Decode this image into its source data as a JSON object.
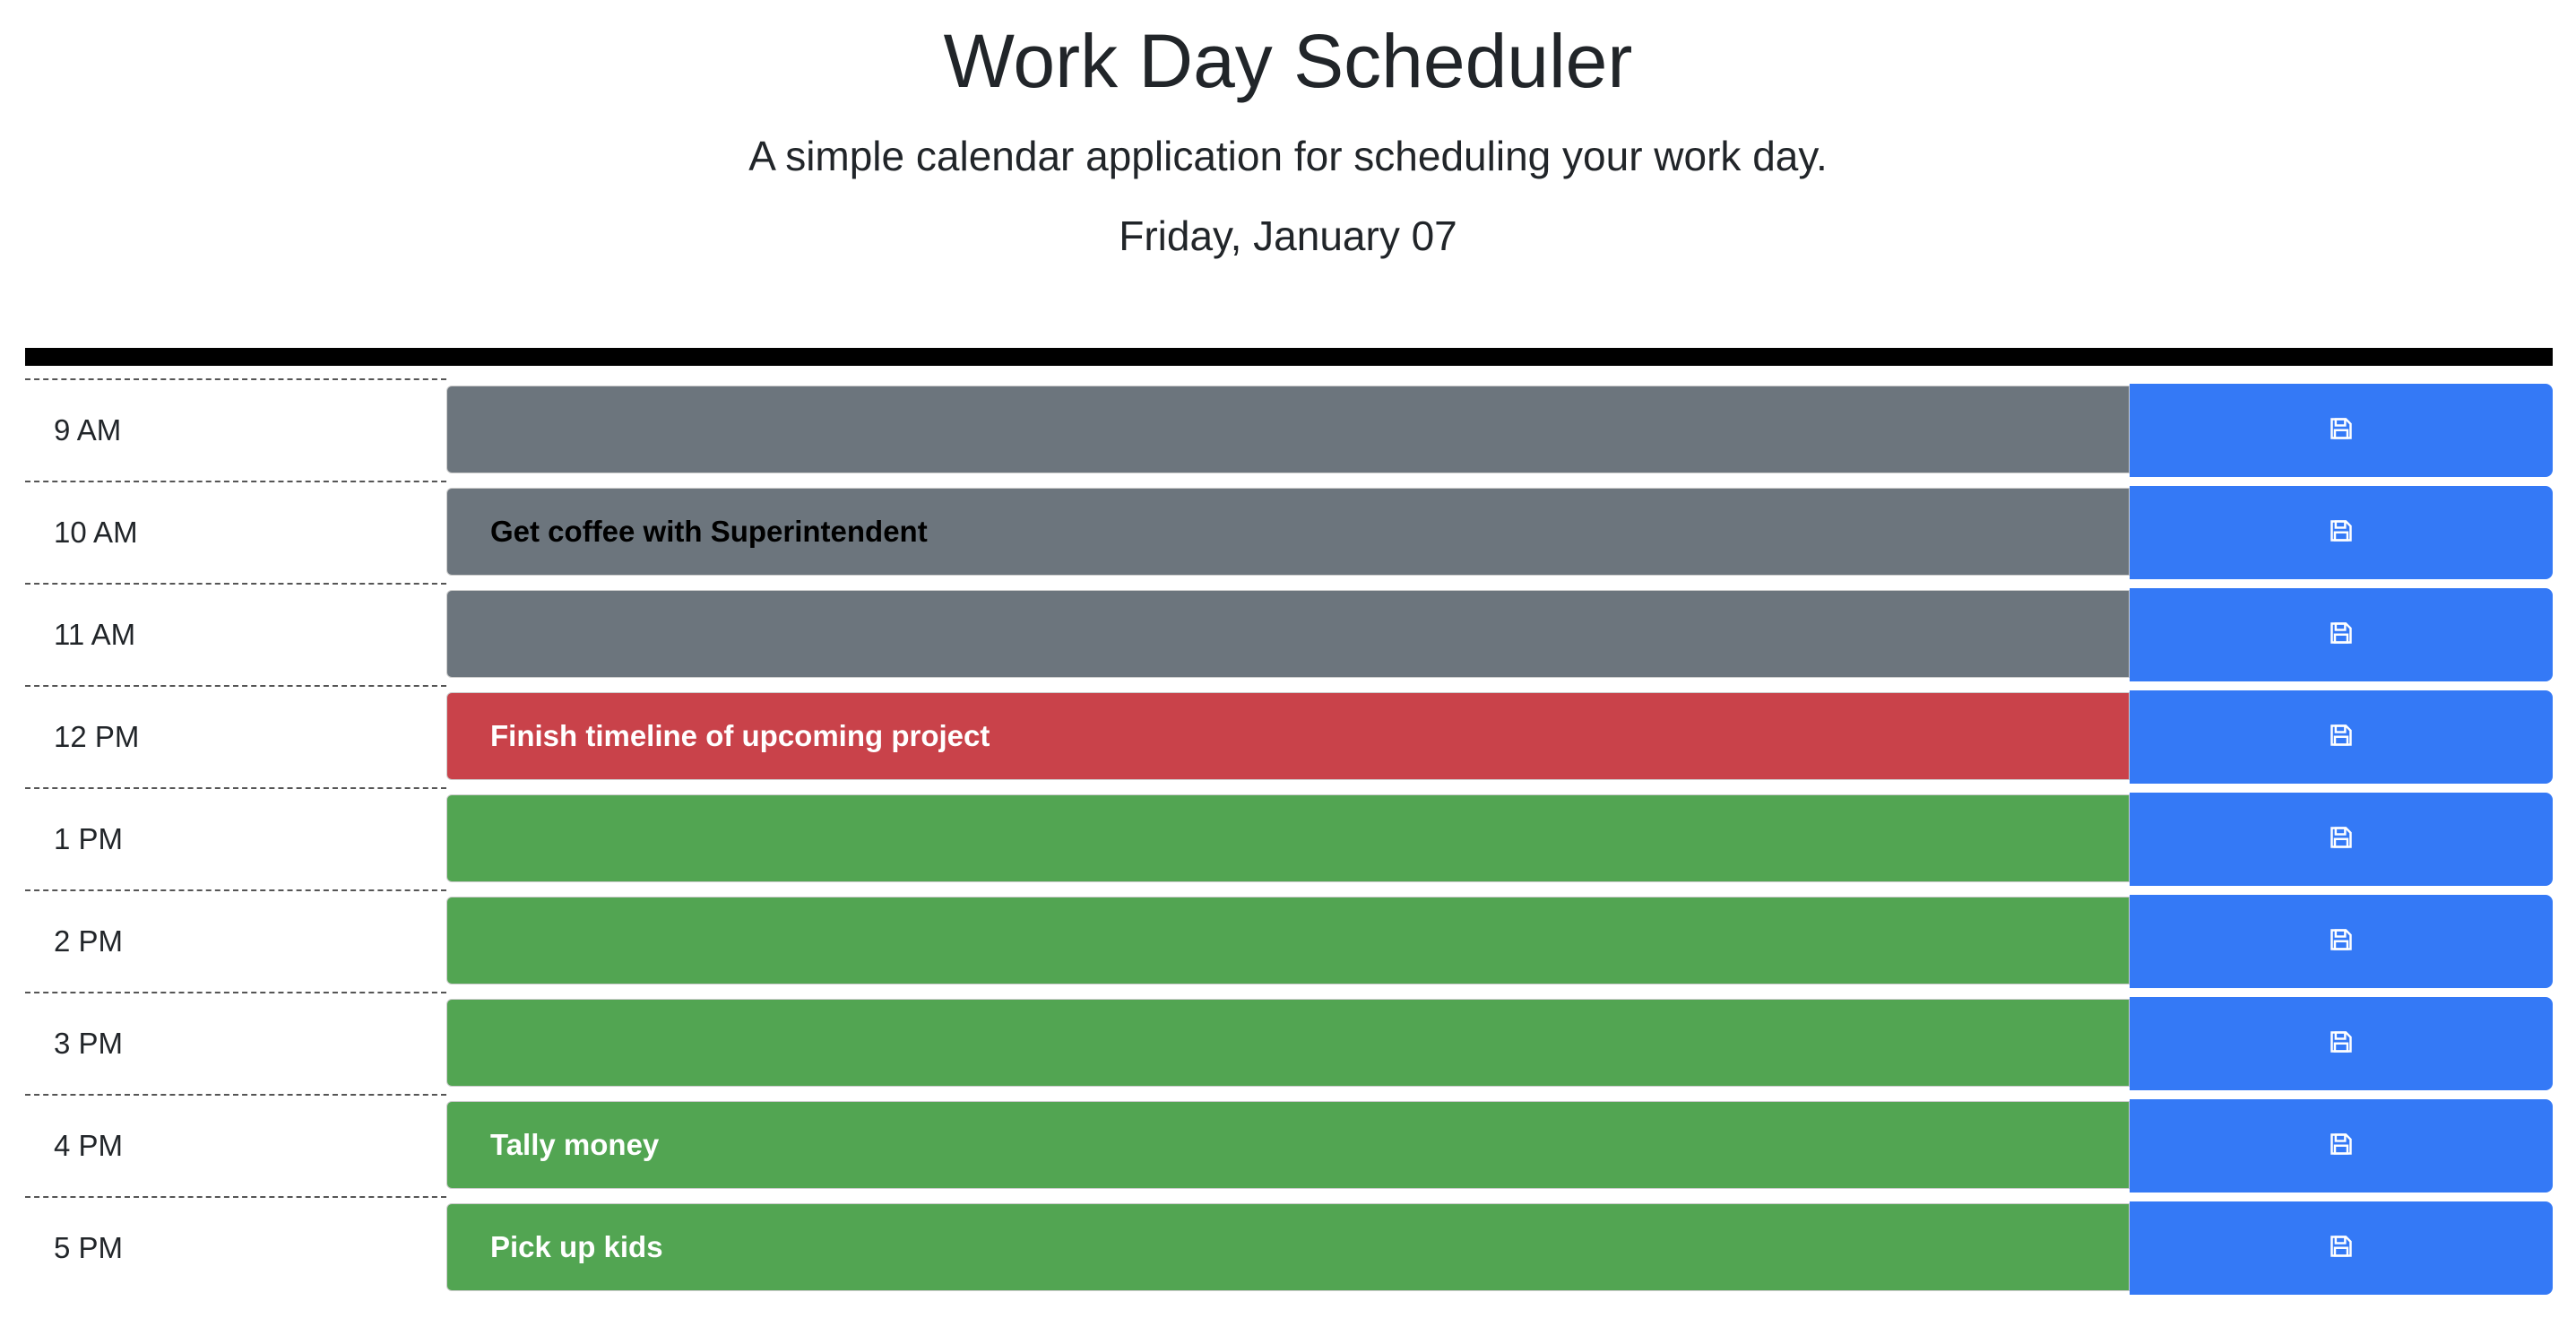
{
  "header": {
    "title": "Work Day Scheduler",
    "lead": "A simple calendar application for scheduling your work day.",
    "date": "Friday, January 07"
  },
  "colors": {
    "past": "#6c757d",
    "present": "#c9424a",
    "future": "#52a552",
    "save": "#3479f6"
  },
  "rows": [
    {
      "hour": "9 AM",
      "text": "",
      "state": "past",
      "save_icon": "floppy-disk-icon"
    },
    {
      "hour": "10 AM",
      "text": "Get coffee with Superintendent",
      "state": "past",
      "save_icon": "floppy-disk-icon"
    },
    {
      "hour": "11 AM",
      "text": "",
      "state": "past",
      "save_icon": "floppy-disk-icon"
    },
    {
      "hour": "12 PM",
      "text": "Finish timeline of upcoming project",
      "state": "present",
      "save_icon": "floppy-disk-icon"
    },
    {
      "hour": "1 PM",
      "text": "",
      "state": "future",
      "save_icon": "floppy-disk-icon"
    },
    {
      "hour": "2 PM",
      "text": "",
      "state": "future",
      "save_icon": "floppy-disk-icon"
    },
    {
      "hour": "3 PM",
      "text": "",
      "state": "future",
      "save_icon": "floppy-disk-icon"
    },
    {
      "hour": "4 PM",
      "text": "Tally money",
      "state": "future",
      "save_icon": "floppy-disk-icon"
    },
    {
      "hour": "5 PM",
      "text": "Pick up kids",
      "state": "future",
      "save_icon": "floppy-disk-icon"
    }
  ]
}
